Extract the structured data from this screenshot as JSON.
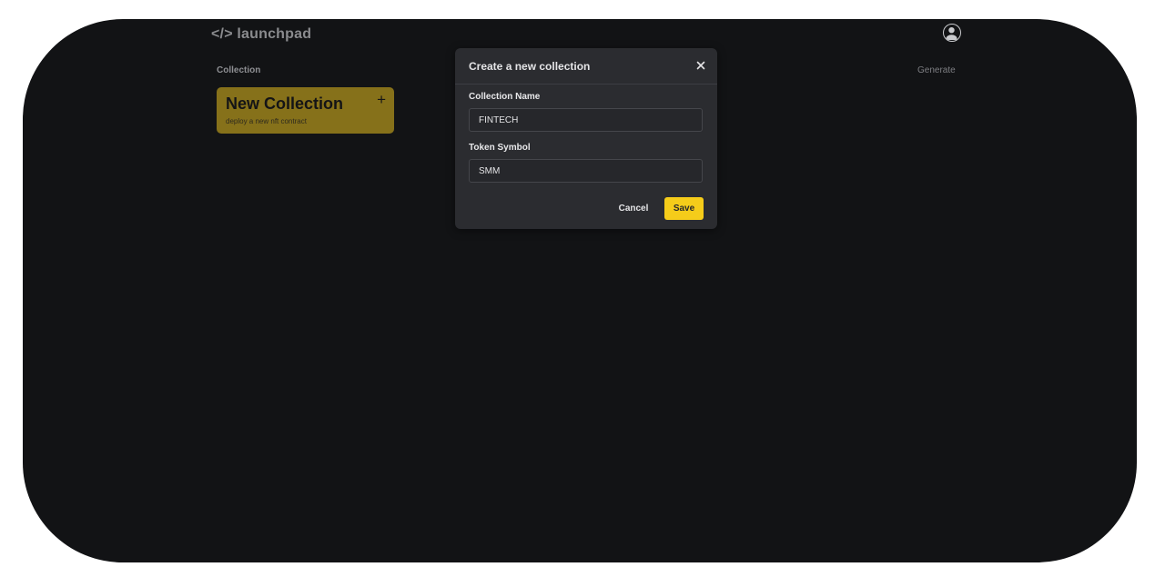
{
  "header": {
    "logo": "</> launchpad",
    "avatar_icon": "user-circle-icon"
  },
  "nav": {
    "collection_label": "Collection",
    "generate_label": "Generate"
  },
  "new_collection_card": {
    "title": "New Collection",
    "subtitle": "deploy a new nft contract",
    "icon": "plus-icon",
    "icon_glyph": "+",
    "color": "#86711a"
  },
  "modal": {
    "title": "Create a new collection",
    "close_icon": "close-icon",
    "collection_name": {
      "label": "Collection Name",
      "value": "FINTECH"
    },
    "token_symbol": {
      "label": "Token Symbol",
      "value": "SMM"
    },
    "cancel_label": "Cancel",
    "save_label": "Save",
    "accent_color": "#f5cc1a"
  },
  "colors": {
    "background": "#121315",
    "modal_background": "#2b2c30"
  }
}
